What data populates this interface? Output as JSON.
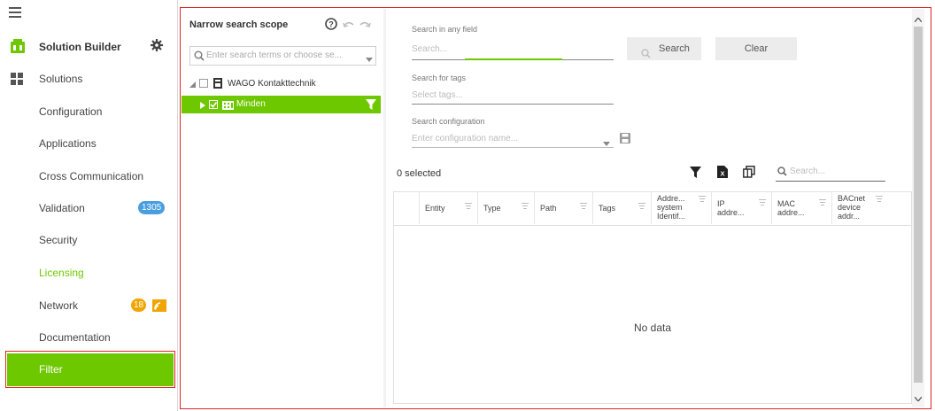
{
  "sidebar": {
    "app_title": "Solution Builder",
    "items": [
      {
        "label": "Solutions"
      },
      {
        "label": "Configuration"
      },
      {
        "label": "Applications"
      },
      {
        "label": "Cross Communication"
      },
      {
        "label": "Validation",
        "badge": "1305"
      },
      {
        "label": "Security"
      },
      {
        "label": "Licensing"
      },
      {
        "label": "Network",
        "badge": "18"
      },
      {
        "label": "Documentation"
      },
      {
        "label": "Filter"
      }
    ]
  },
  "tree": {
    "title": "Narrow search scope",
    "search_placeholder": "Enter search terms or choose se...",
    "nodes": [
      {
        "label": "WAGO Kontakttechnik"
      },
      {
        "label": "Minden"
      }
    ]
  },
  "search": {
    "any_field_label": "Search in any field",
    "any_field_placeholder": "Search...",
    "search_button": "Search",
    "clear_button": "Clear",
    "tags_label": "Search for tags",
    "tags_placeholder": "Select tags...",
    "config_label": "Search configuration",
    "config_placeholder": "Enter configuration name..."
  },
  "grid": {
    "selected_count": "0 selected",
    "search_placeholder": "Search...",
    "columns": [
      {
        "label": "Entity"
      },
      {
        "label": "Type"
      },
      {
        "label": "Path"
      },
      {
        "label": "Tags"
      },
      {
        "label": "Addre... system Identif..."
      },
      {
        "label": "IP addre..."
      },
      {
        "label": "MAC addre..."
      },
      {
        "label": "BACnet device addr..."
      }
    ],
    "empty_text": "No data"
  },
  "colors": {
    "accent": "#6ec800",
    "badge_blue": "#4a9ee0",
    "badge_orange": "#f0a500",
    "highlight": "#e02424"
  }
}
